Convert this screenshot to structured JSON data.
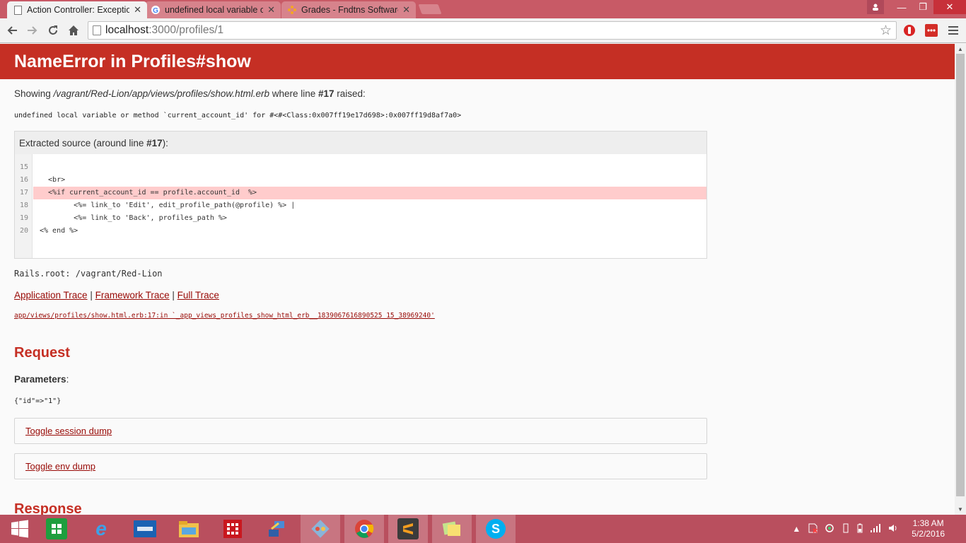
{
  "browser": {
    "tabs": [
      {
        "title": "Action Controller: Exceptio",
        "active": true
      },
      {
        "title": "undefined local variable o",
        "active": false
      },
      {
        "title": "Grades - Fndtns Software",
        "active": false
      }
    ],
    "url_host": "localhost",
    "url_path": ":3000/profiles/1"
  },
  "page": {
    "heading": "NameError in Profiles#show",
    "showing_prefix": "Showing ",
    "showing_file": "/vagrant/Red-Lion/app/views/profiles/show.html.erb",
    "showing_mid": " where line ",
    "showing_line": "#17",
    "showing_suffix": " raised:",
    "error_message": "undefined local variable or method `current_account_id' for #<#<Class:0x007ff19e17d698>:0x007ff19d8af7a0>",
    "source_header_prefix": "Extracted source (around line ",
    "source_header_line": "#17",
    "source_header_suffix": "):",
    "code_lines": [
      {
        "num": "15",
        "code": ""
      },
      {
        "num": "16",
        "code": "  <br>"
      },
      {
        "num": "17",
        "code": "  <%if current_account_id == profile.account_id  %>"
      },
      {
        "num": "18",
        "code": "        <%= link_to 'Edit', edit_profile_path(@profile) %> |"
      },
      {
        "num": "19",
        "code": "        <%= link_to 'Back', profiles_path %>"
      },
      {
        "num": "20",
        "code": "<% end %>"
      }
    ],
    "rails_root": "Rails.root: /vagrant/Red-Lion",
    "trace_links": [
      "Application Trace",
      "Framework Trace",
      "Full Trace"
    ],
    "trace_separator": " | ",
    "trace_path": "app/views/profiles/show.html.erb:17:in `_app_views_profiles_show_html_erb__1839067616890525 15_38969240'",
    "request_heading": "Request",
    "parameters_label": "Parameters",
    "parameters_colon": ":",
    "parameters_value": "{\"id\"=>\"1\"}",
    "toggle_session": "Toggle session dump",
    "toggle_env": "Toggle env dump",
    "response_heading": "Response"
  },
  "taskbar": {
    "apps": [
      "start-icon",
      "store-icon",
      "internet-explorer-icon",
      "lenovo-icon",
      "file-explorer-icon",
      "app-red-icon",
      "network-app-icon",
      "git-icon",
      "chrome-icon",
      "sublime-text-icon",
      "sticky-notes-icon",
      "skype-icon"
    ],
    "time": "1:38 AM",
    "date": "5/2/2016"
  }
}
